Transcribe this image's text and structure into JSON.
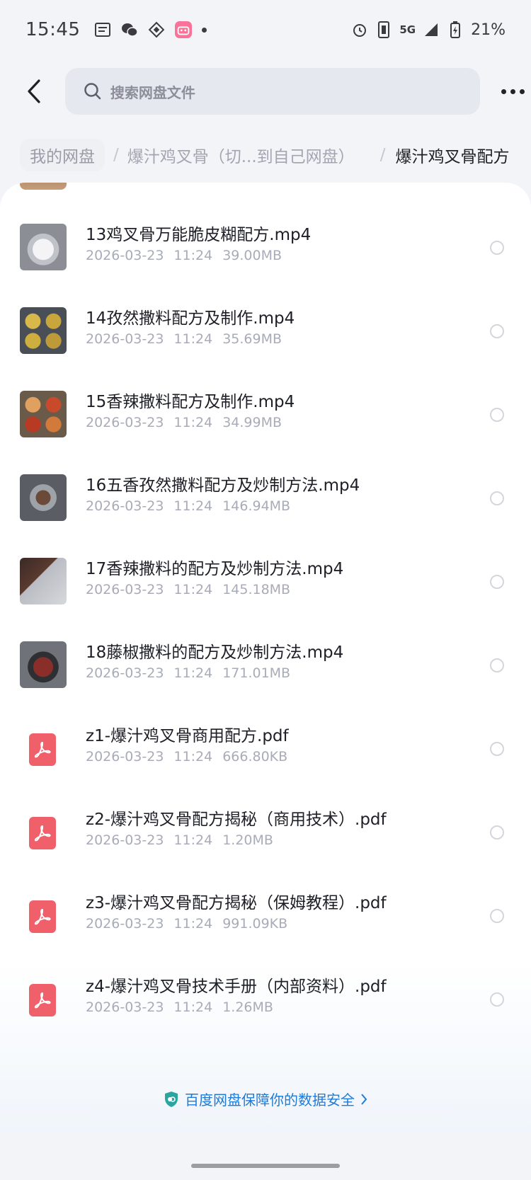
{
  "status_bar": {
    "time": "15:45",
    "battery": "21%",
    "network": "5G"
  },
  "header": {
    "search_placeholder": "搜索网盘文件"
  },
  "breadcrumb": {
    "items": [
      "我的网盘",
      "爆汁鸡叉骨（切...到自己网盘）"
    ],
    "current": "爆汁鸡叉骨配方"
  },
  "files": [
    {
      "name": "13鸡叉骨万能脆皮糊配方.mp4",
      "date": "2026-03-23",
      "time": "11:24",
      "size": "39.00MB",
      "type": "video"
    },
    {
      "name": "14孜然撒料配方及制作.mp4",
      "date": "2026-03-23",
      "time": "11:24",
      "size": "35.69MB",
      "type": "video"
    },
    {
      "name": "15香辣撒料配方及制作.mp4",
      "date": "2026-03-23",
      "time": "11:24",
      "size": "34.99MB",
      "type": "video"
    },
    {
      "name": "16五香孜然撒料配方及炒制方法.mp4",
      "date": "2026-03-23",
      "time": "11:24",
      "size": "146.94MB",
      "type": "video"
    },
    {
      "name": "17香辣撒料的配方及炒制方法.mp4",
      "date": "2026-03-23",
      "time": "11:24",
      "size": "145.18MB",
      "type": "video"
    },
    {
      "name": "18藤椒撒料的配方及炒制方法.mp4",
      "date": "2026-03-23",
      "time": "11:24",
      "size": "171.01MB",
      "type": "video"
    },
    {
      "name": "z1-爆汁鸡叉骨商用配方.pdf",
      "date": "2026-03-23",
      "time": "11:24",
      "size": "666.80KB",
      "type": "pdf"
    },
    {
      "name": "z2-爆汁鸡叉骨配方揭秘（商用技术）.pdf",
      "date": "2026-03-23",
      "time": "11:24",
      "size": "1.20MB",
      "type": "pdf"
    },
    {
      "name": "z3-爆汁鸡叉骨配方揭秘（保姆教程）.pdf",
      "date": "2026-03-23",
      "time": "11:24",
      "size": "991.09KB",
      "type": "pdf"
    },
    {
      "name": "z4-爆汁鸡叉骨技术手册（内部资料）.pdf",
      "date": "2026-03-23",
      "time": "11:24",
      "size": "1.26MB",
      "type": "pdf"
    }
  ],
  "footer": {
    "safety_text": "百度网盘保障你的数据安全"
  },
  "icons": {
    "back": "chevron-left-icon",
    "search": "search-icon",
    "more": "more-icon",
    "pdf": "pdf-icon",
    "shield": "shield-icon"
  },
  "colors": {
    "accent": "#1f7bd6",
    "pdf": "#f0606a",
    "background": "#f3f4f8"
  }
}
